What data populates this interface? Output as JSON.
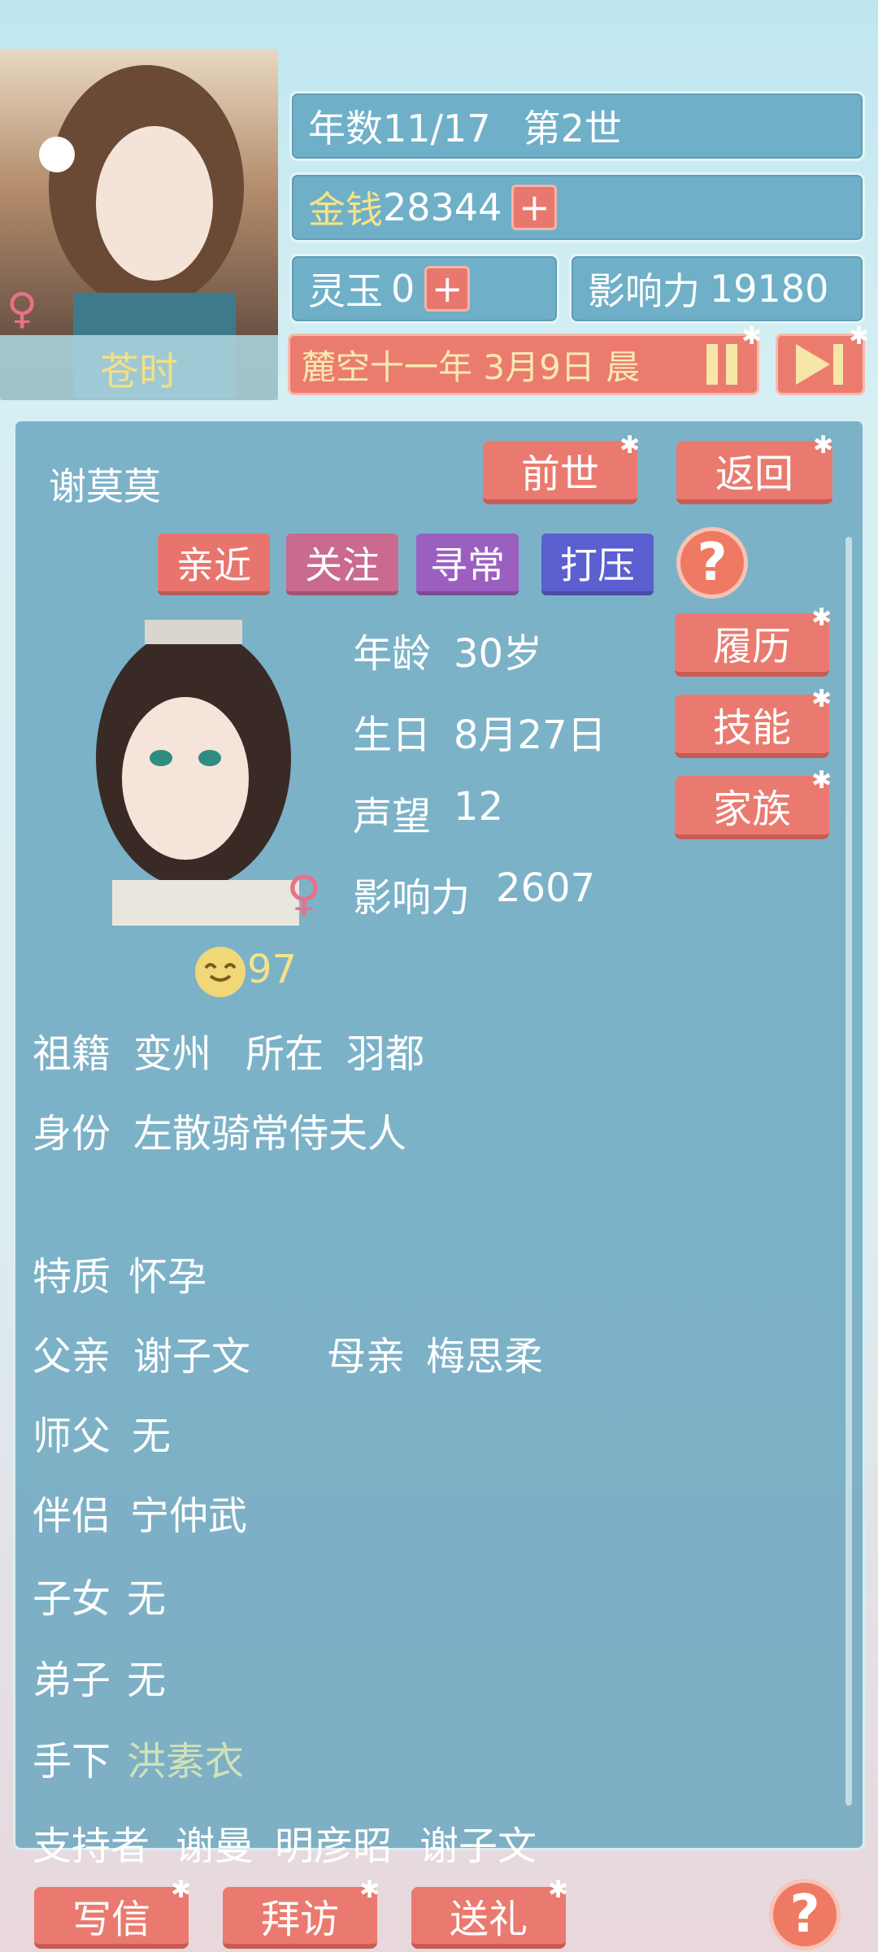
{
  "player": {
    "name": "苍时",
    "gender_symbol": "♀"
  },
  "header": {
    "year_label": "年数11/17",
    "generation": "第2世",
    "money_label": "金钱",
    "money_value": "28344",
    "plus": "+",
    "jade_label": "灵玉",
    "jade_value": "0",
    "influence_label": "影响力",
    "influence_value": "19180",
    "date": "麓空十一年 3月9日 晨",
    "pause_icon": "pause-icon",
    "skip_icon": "skip-icon"
  },
  "character": {
    "name": "谢莫莫",
    "prev_life_button": "前世",
    "back_button": "返回",
    "attitude_tags": [
      "亲近",
      "关注",
      "寻常",
      "打压"
    ],
    "help": "?",
    "age_label": "年龄",
    "age_value": "30岁",
    "birthday_label": "生日",
    "birthday_value": "8月27日",
    "reputation_label": "声望",
    "reputation_value": "12",
    "influence_label": "影响力",
    "influence_value": "2607",
    "resume_button": "履历",
    "skill_button": "技能",
    "family_button": "家族",
    "gender_symbol": "♀",
    "mood_value": "97",
    "hometown_label": "祖籍",
    "hometown_value": "变州",
    "location_label": "所在",
    "location_value": "羽都",
    "identity_label": "身份",
    "identity_value": "左散骑常侍夫人",
    "trait_label": "特质",
    "trait_value": "怀孕",
    "father_label": "父亲",
    "father_value": "谢子文",
    "mother_label": "母亲",
    "mother_value": "梅思柔",
    "master_label": "师父",
    "master_value": "无",
    "partner_label": "伴侣",
    "partner_value": "宁仲武",
    "children_label": "子女",
    "children_value": "无",
    "disciple_label": "弟子",
    "disciple_value": "无",
    "subordinate_label": "手下",
    "subordinate_value": "洪素衣",
    "supporter_label": "支持者",
    "supporters": [
      "谢曼",
      "明彦昭",
      "谢子文"
    ]
  },
  "footer": {
    "letter_button": "写信",
    "visit_button": "拜访",
    "gift_button": "送礼",
    "help": "?"
  },
  "colors": {
    "accent_red": "#ea7a6f",
    "gold_text": "#f4e38a",
    "panel_blue": "#66a5be",
    "tag_purple": "#9b5fc0",
    "tag_blue": "#5b5fd0"
  }
}
